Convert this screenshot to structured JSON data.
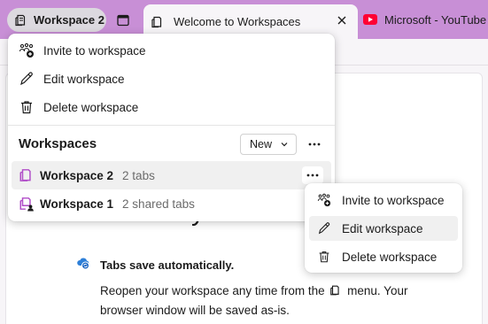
{
  "tabstrip": {
    "workspace_label": "Workspace 2",
    "active_tab_title": "Welcome to Workspaces",
    "inactive_tab_title": "Microsoft - YouTube",
    "colors": {
      "strip": "#c88fd6",
      "accent": "#b04cc8",
      "youtube": "#ff0033"
    }
  },
  "flyout": {
    "menu": [
      {
        "label": "Invite to workspace",
        "icon": "invite-icon"
      },
      {
        "label": "Edit workspace",
        "icon": "pencil-icon"
      },
      {
        "label": "Delete workspace",
        "icon": "trash-icon"
      }
    ],
    "heading": "Workspaces",
    "new_label": "New",
    "workspaces": [
      {
        "name": "Workspace 2",
        "meta": "2 tabs",
        "selected": true
      },
      {
        "name": "Workspace 1",
        "meta": "2 shared tabs",
        "selected": false
      }
    ]
  },
  "context_menu": {
    "items": [
      {
        "label": "Invite to workspace",
        "icon": "invite-icon"
      },
      {
        "label": "Edit workspace",
        "icon": "pencil-icon",
        "hover": true
      },
      {
        "label": "Delete workspace",
        "icon": "trash-icon"
      }
    ]
  },
  "page": {
    "hero": "A new way to brow",
    "feature_title": "Tabs save automatically.",
    "feature_body_1": "Reopen your workspace any time from the",
    "feature_body_2": "menu. Your",
    "feature_body_3": "browser window will be saved as-is."
  }
}
